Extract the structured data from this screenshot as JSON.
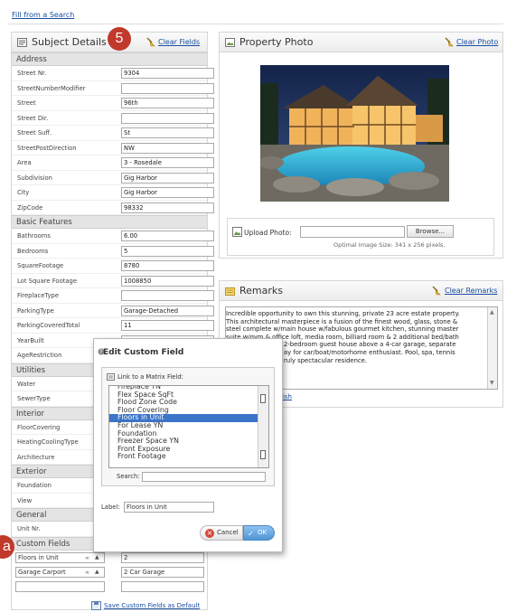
{
  "top_link": "Fill from a Search",
  "badges": {
    "five": "5",
    "a": "a"
  },
  "subject": {
    "title": "Subject Details",
    "clear_label": "Clear Fields",
    "sections": {
      "address": "Address",
      "basic": "Basic Features",
      "utilities": "Utilities",
      "interior": "Interior",
      "exterior": "Exterior",
      "general": "General",
      "custom": "Custom Fields"
    },
    "address": [
      {
        "label": "Street Nr.",
        "value": "9304"
      },
      {
        "label": "StreetNumberModifier",
        "value": ""
      },
      {
        "label": "Street",
        "value": "96th"
      },
      {
        "label": "Street Dir.",
        "value": ""
      },
      {
        "label": "Street Suff.",
        "value": "St"
      },
      {
        "label": "StreetPostDirection",
        "value": "NW"
      },
      {
        "label": "Area",
        "value": "3 - Rosedale"
      },
      {
        "label": "Subdivision",
        "value": "Gig Harbor"
      },
      {
        "label": "City",
        "value": "Gig Harbor"
      },
      {
        "label": "ZipCode",
        "value": "98332"
      }
    ],
    "basic": [
      {
        "label": "Bathrooms",
        "value": "6.00"
      },
      {
        "label": "Bedrooms",
        "value": "5"
      },
      {
        "label": "SquareFootage",
        "value": "8780"
      },
      {
        "label": "Lot Square Footage",
        "value": "1008850"
      },
      {
        "label": "FireplaceType",
        "value": ""
      },
      {
        "label": "ParkingType",
        "value": "Garage-Detached"
      },
      {
        "label": "ParkingCoveredTotal",
        "value": "11"
      },
      {
        "label": "YearBuilt",
        "value": ""
      },
      {
        "label": "AgeRestriction",
        "value": ""
      }
    ],
    "utilities": [
      {
        "label": "Water",
        "value": ""
      },
      {
        "label": "SewerType",
        "value": ""
      }
    ],
    "interior": [
      {
        "label": "FloorCovering",
        "value": ""
      },
      {
        "label": "HeatingCoolingType",
        "value": ""
      },
      {
        "label": "Architecture",
        "value": ""
      }
    ],
    "exterior": [
      {
        "label": "Foundation",
        "value": ""
      },
      {
        "label": "View",
        "value": ""
      }
    ],
    "general": [
      {
        "label": "Unit Nr.",
        "value": ""
      }
    ],
    "custom_fields": [
      {
        "name": "Floors in Unit",
        "value": "2"
      },
      {
        "name": "Garage Carport",
        "value": "2 Car Garage"
      },
      {
        "name": "",
        "value": ""
      }
    ],
    "save_default_label": "Save Custom Fields as Default"
  },
  "photo": {
    "title": "Property Photo",
    "clear_label": "Clear Photo",
    "upload_label": "Upload Photo:",
    "browse_label": "Browse...",
    "optimal_size_text": "Optimal Image Size: 341 x 256 pixels."
  },
  "remarks": {
    "title": "Remarks",
    "clear_label": "Clear Remarks",
    "lines": [
      "Incredible opportunity to own this stunning, private 23 acre estate property.",
      "This architectural masterpiece is a fusion of the finest wood, glass, stone &",
      "steel complete w/main house w/fabulous gourmet kitchen, stunning master",
      "suite w/gym & office loft, media room, billiard room & 2 additional bed/bath",
      "2-bedroom guest house above a 4-car garage, separate",
      "ay for car/boat/motorhome enthusiast. Pool, spa, tennis",
      "ruly spectacular residence."
    ],
    "partial_link": "lish"
  },
  "dialog": {
    "title": "Edit Custom Field",
    "link_label": "Link to a Matrix Field:",
    "options": [
      "Fireplace YN",
      "Flex Space SqFt",
      "Flood Zone Code",
      "Floor Covering",
      "Floors in Unit",
      "For Lease YN",
      "Foundation",
      "Freezer Space YN",
      "Front Exposure",
      "Front Footage"
    ],
    "selected_option": "Floors in Unit",
    "search_label": "Search:",
    "search_value": "",
    "label_label": "Label:",
    "label_value": "Floors in Unit",
    "cancel_label": "Cancel",
    "ok_label": "OK"
  },
  "colors": {
    "link": "#1a4fa3",
    "badge": "#c0392b",
    "selection": "#3b74c9",
    "ok_button": "#4f94d6",
    "cancel_icon": "#d9463a"
  }
}
